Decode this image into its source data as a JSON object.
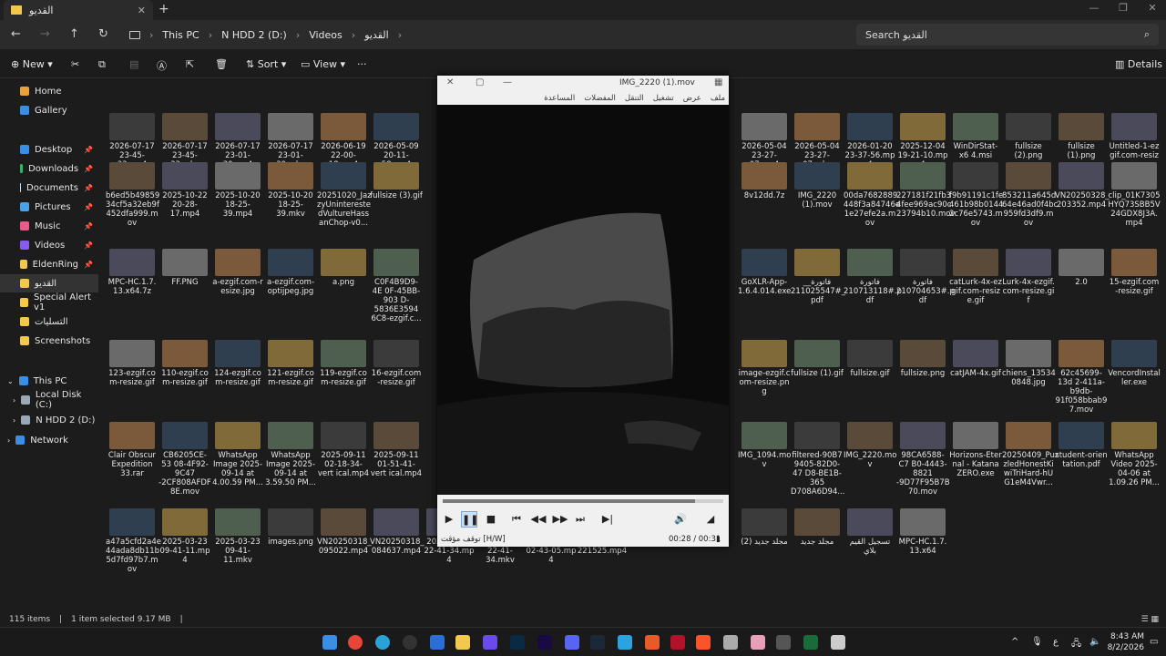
{
  "tab": {
    "label": "القديو",
    "close": "✕",
    "new": "+"
  },
  "nav": {
    "back": "←",
    "forward": "→",
    "up": "↑",
    "refresh": "↻"
  },
  "breadcrumb": [
    "This PC",
    "N HDD 2 (D:)",
    "Videos",
    "القديو"
  ],
  "search": {
    "placeholder": "Search القديو"
  },
  "commands": {
    "new": "New",
    "sort": "Sort",
    "view": "View",
    "more": "···",
    "details": "Details"
  },
  "sidebar": {
    "items": [
      {
        "label": "Home",
        "pinned": false
      },
      {
        "label": "Gallery",
        "pinned": false
      },
      {
        "label": "Desktop",
        "pinned": true
      },
      {
        "label": "Downloads",
        "pinned": true
      },
      {
        "label": "Documents",
        "pinned": true
      },
      {
        "label": "Pictures",
        "pinned": true
      },
      {
        "label": "Music",
        "pinned": true
      },
      {
        "label": "Videos",
        "pinned": true
      },
      {
        "label": "EldenRing",
        "pinned": true
      },
      {
        "label": "القديو",
        "pinned": false
      },
      {
        "label": "Special Alert v1",
        "pinned": false
      },
      {
        "label": "التسليات",
        "pinned": false
      },
      {
        "label": "Screenshots",
        "pinned": false
      },
      {
        "label": "This PC",
        "pinned": false
      },
      {
        "label": "Local Disk (C:)",
        "pinned": false
      },
      {
        "label": "N HDD 2 (D:)",
        "pinned": false
      },
      {
        "label": "Network",
        "pinned": false
      }
    ]
  },
  "files_left": [
    [
      "2026-07-17 23-45-33.mp4",
      "2026-07-17 23-45-33.mkv",
      "2026-07-17 23-01-30.mp4",
      "2026-07-17 23-01-30.mkv",
      "2026-06-19 22-00-18.mp4",
      "2026-05-09 20-11-58.mp4"
    ],
    [
      "b6ed5b49859 34cf5a32eb9f 452dfa999.m ov",
      "2025-10-22 20-28-17.mp4",
      "2025-10-20 18-25-39.mp4",
      "2025-10-20 18-25-39.mkv",
      "20251020_Jaz zyUnintereste dVultureHass anChop-v0...",
      "fullsize (3).gif"
    ],
    [
      "MPC-HC.1.7. 13.x64.7z",
      "FF.PNG",
      "a-ezgif.com-r esize.jpg",
      "a-ezgif.com- optijpeg.jpg",
      "a.png",
      "C0F4B9D9-4E 0F-45BB-903 D-5836E3594 6C8-ezgif.c..."
    ],
    [
      "123-ezgif.co m-resize.gif",
      "110-ezgif.co m-resize.gif",
      "124-ezgif.co m-resize.gif",
      "121-ezgif.co m-resize.gif",
      "119-ezgif.co m-resize.gif",
      "16-ezgif.com -resize.gif"
    ],
    [
      "Clair Obscur Expedition 33.rar",
      "CB6205CE-53 08-4F92-9C47 -2CF808AFDF 8E.mov",
      "WhatsApp Image 2025-09-14 at 4.00.59 PM...",
      "WhatsApp Image 2025-09-14 at 3.59.50 PM...",
      "2025-09-11 02-18-34-vert ical.mp4",
      "2025-09-11 01-51-41-vert ical.mp4"
    ],
    [
      "a47a5cfd2a4e 44ada8db11b 5d7fd97b7.m ov",
      "2025-03-23 09-41-11.mp 4",
      "2025-03-23 09-41-11.mkv",
      "images.png",
      "VN20250318_ 095022.mp4",
      "VN20250318_ 084637.mp4"
    ]
  ],
  "files_right": [
    [
      "2026-05-04 23-27-07.mp4",
      "2026-05-04 23-27-07.mkv",
      "2026-01-20 23-37-56.mp 4",
      "2025-12-04 19-21-10.mp 4",
      "WinDirStat-x6 4.msi",
      "fullsize (2).png",
      "fullsize (1).png",
      "Untitled-1-ez gif.com-resiz e.png"
    ],
    [
      "8v12dd.7z",
      "IMG_2220 (1).mov",
      "00da7682889 448f3a84746e 1e27efe2a.m ov",
      "227181f21fb3 4fee969ac90c 23794b10.mov",
      "f9b91191c1fe 461b98b0144 2c76e5743.m ov",
      "853211a645d 64e46ad0f4bc 959fd3df9.m ov",
      "VN20250328_ 203352.mp4",
      "clip_01K7305 HYQ73SBB5V 24GDX8J3A. mp4"
    ],
    [
      "GoXLR-App- 1.6.4.014.exe",
      "فاتورة__ #211025547_ pdf",
      "فاتورة #210713118.p df",
      "فاتورة #210704653.p df",
      "catLurk-4x-ez gif.com-resiz e.gif",
      "Lurk-4x-ezgif. com-resize.gi f",
      "2.0",
      "15-ezgif.com -resize.gif"
    ],
    [
      "image-ezgif.c om-resize.pn g",
      "fullsize (1).gif",
      "fullsize.gif",
      "fullsize.png",
      "catJAM-4x.gif",
      "chiens_13534 0848.jpg",
      "62c45699-13d 2-411a-b9db- 91f058bbab9 7.mov",
      "VencordInstal ler.exe"
    ],
    [
      "IMG_1094.mo v",
      "filtered-90B7 9405-82D0-47 D8-BE1B-365 D708A6D94...",
      "IMG_2220.mo v",
      "98CA6588-C7 B0-4443-8821 -9D77F95B7B 70.mov",
      "Horizons-Eter nal - Katana ZERO.exe",
      "20250409_Puz zledHonestKi wiTriHard-hU G1eM4Vwr...",
      "student-orien tation.pdf",
      "WhatsApp Video 2025-04-06 at 1.09.26 PM..."
    ],
    [
      "مجلد جديد (2)",
      "مجلد جديد",
      "تسجيل القيم بلاي",
      "MPC-HC.1.7. 13.x64"
    ]
  ],
  "files_mid_bottom": [
    "2025-03-16 22-41-34.mp 4",
    "2025-03-16 22-41-34.mkv",
    "2025-03-16 02-43-05.mp 4",
    "VN20250318_ 221525.mp4",
    "تسجيل القيم"
  ],
  "status": {
    "count": "115 items",
    "selected": "1 item selected  9.17 MB"
  },
  "player": {
    "title": "IMG_2220 (1).mov",
    "menu": [
      "ملف",
      "عرض",
      "تشغيل",
      "التنقل",
      "المفضلات",
      "المساعدة"
    ],
    "progress": 0.9,
    "time": "00:28 / 00:31",
    "status_text": "توقف مؤقت [H/W]",
    "volume_icon": "speaker-icon"
  },
  "clock": {
    "time": "8:43 AM",
    "date": "8/2/2026"
  },
  "tray": {
    "lang": "ع",
    "chev": "^"
  }
}
